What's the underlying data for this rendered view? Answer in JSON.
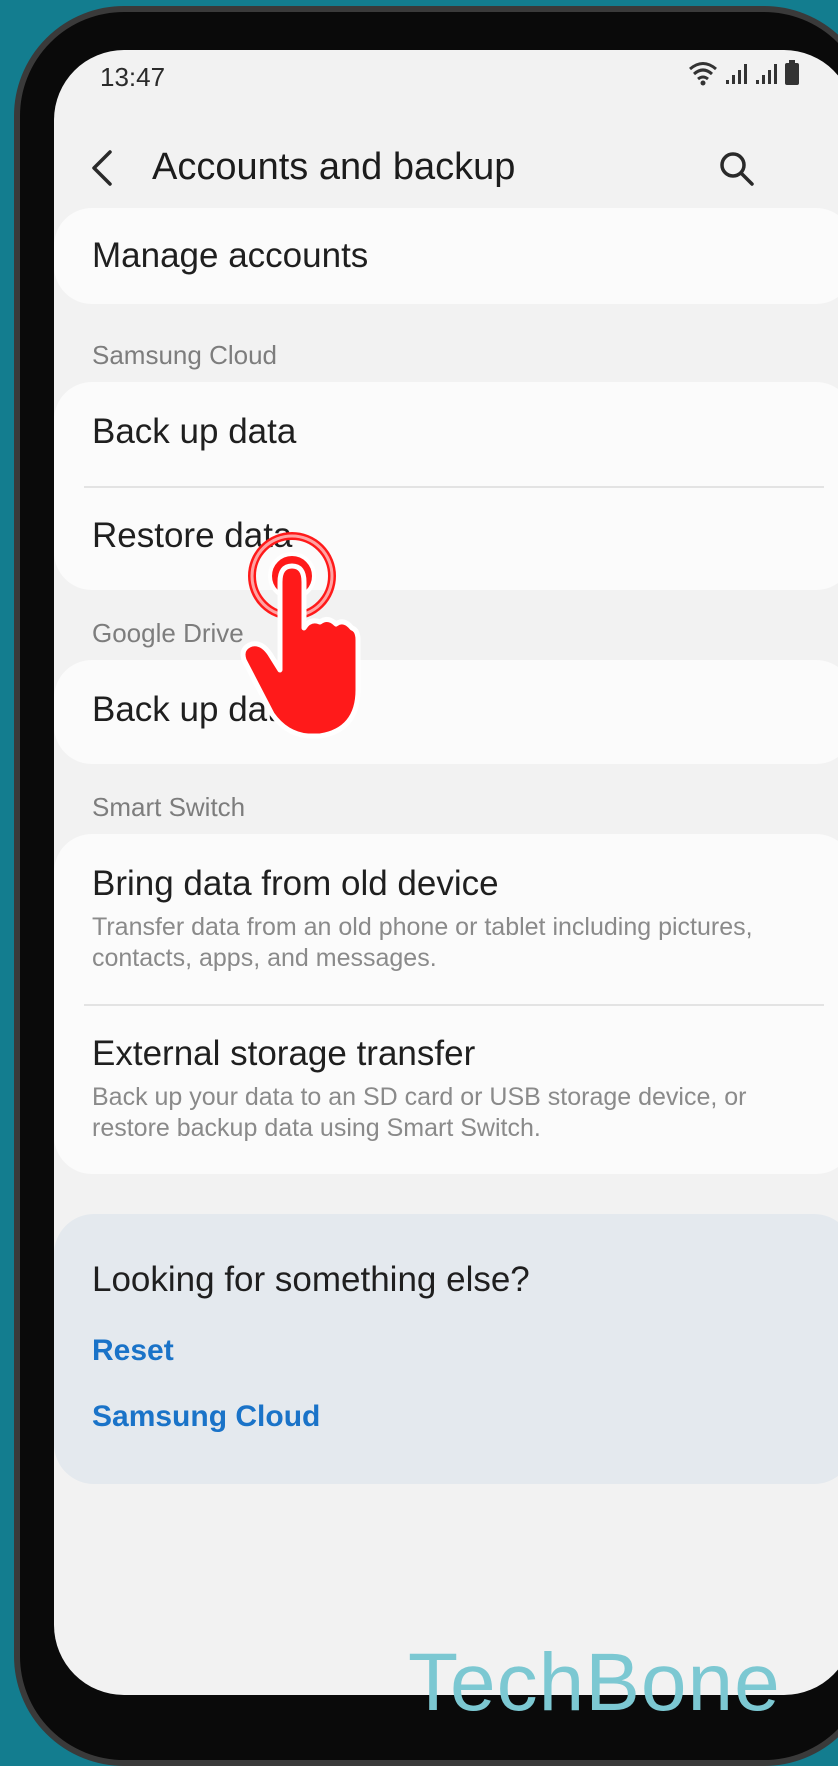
{
  "status_bar": {
    "time": "13:47"
  },
  "header": {
    "title": "Accounts and backup"
  },
  "items": {
    "manage_accounts": "Manage accounts",
    "samsung_cloud_label": "Samsung Cloud",
    "back_up_data": "Back up data",
    "restore_data": "Restore data",
    "google_drive_label": "Google Drive",
    "google_back_up": "Back up data",
    "smart_switch_label": "Smart Switch",
    "bring_data_title": "Bring data from old device",
    "bring_data_sub": "Transfer data from an old phone or tablet including pictures, contacts, apps, and messages.",
    "external_title": "External storage transfer",
    "external_sub": "Back up your data to an SD card or USB storage device, or restore backup data using Smart Switch."
  },
  "help": {
    "title": "Looking for something else?",
    "links": [
      "Reset",
      "Samsung Cloud"
    ]
  },
  "watermark": "TechBone",
  "icons": [
    "back-arrow-icon",
    "search-icon",
    "wifi-icon",
    "signal-icon",
    "battery-icon",
    "tap-hand-icon"
  ],
  "colors": {
    "link": "#1a73c8",
    "accent_hand": "#ff1a1a",
    "background": "#137d8f"
  }
}
